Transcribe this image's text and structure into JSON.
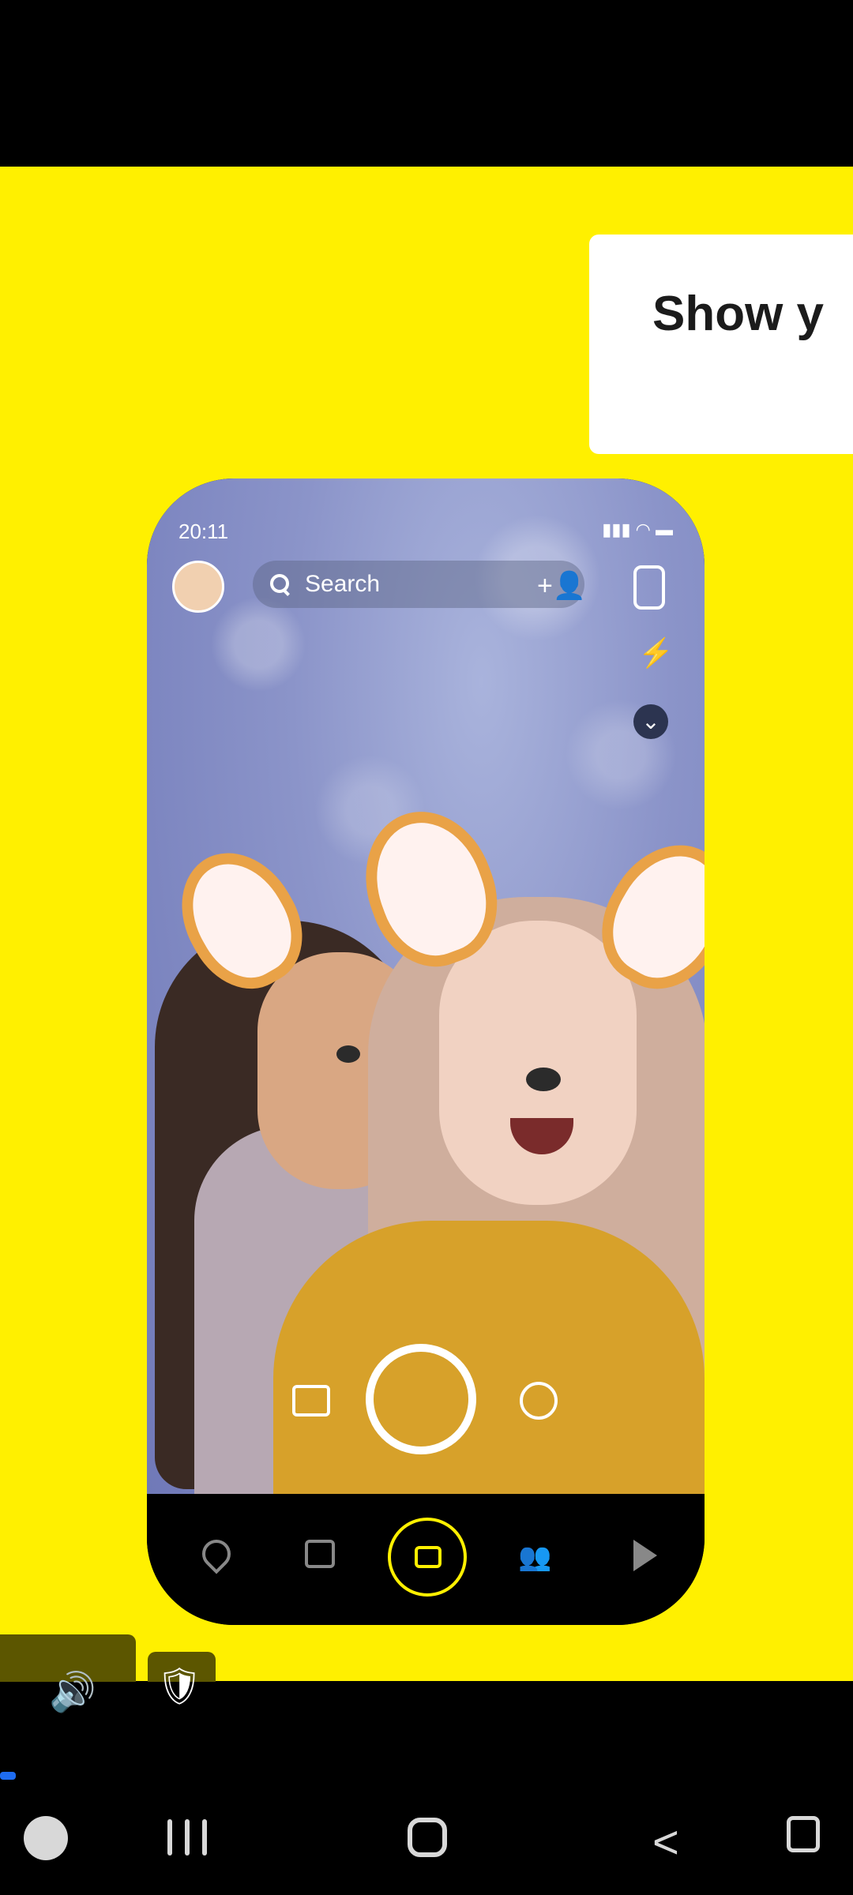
{
  "promo": {
    "text": "Show y"
  },
  "phone": {
    "status": {
      "time": "20:11",
      "icons": "▮▮▮ ◠ ▬"
    },
    "search": {
      "label": "Search"
    },
    "icons": {
      "avatar": "bitmoji-avatar-icon",
      "add_friend": "+👤",
      "flash": "⚡",
      "more": "⌄",
      "friends": "👥"
    }
  },
  "overlay": {
    "volume_icon": "🔊",
    "shield_icon": "🛡"
  },
  "system_nav": {
    "back": "<"
  }
}
